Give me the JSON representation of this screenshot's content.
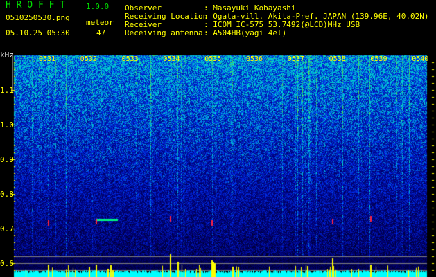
{
  "header": {
    "app_title": "H R O F F T",
    "version": "1.0.0",
    "filename": "0510250530.png",
    "datetime": "05.10.25 05:30",
    "meteor_label": "meteor",
    "meteor_count": "47",
    "info": [
      {
        "label": "Observer",
        "value": ": Masayuki Kobayashi"
      },
      {
        "label": "Receiving Location",
        "value": ": Ogata-vill. Akita-Pref. JAPAN (139.96E, 40.02N)"
      },
      {
        "label": "Receiver",
        "value": ": ICOM IC-575 53.7492(@LCD)MHz USB"
      },
      {
        "label": "Receiving antenna",
        "value": ": A504HB(yagi 4el)"
      }
    ]
  },
  "spectrogram": {
    "y_unit": "kHz",
    "y_ticks": [
      "1.1",
      "1.0",
      "0.9",
      "0.8",
      "0.7",
      "0.6"
    ],
    "time_labels": [
      "0531",
      "0532",
      "0533",
      "0534",
      "0535",
      "0536",
      "0537",
      "0538",
      "0539",
      "0540"
    ],
    "colors": {
      "text": "#ffff00",
      "title": "#00e000",
      "histogram": "#00ffff",
      "spike": "#ffff00",
      "guide": "#808080"
    }
  }
}
